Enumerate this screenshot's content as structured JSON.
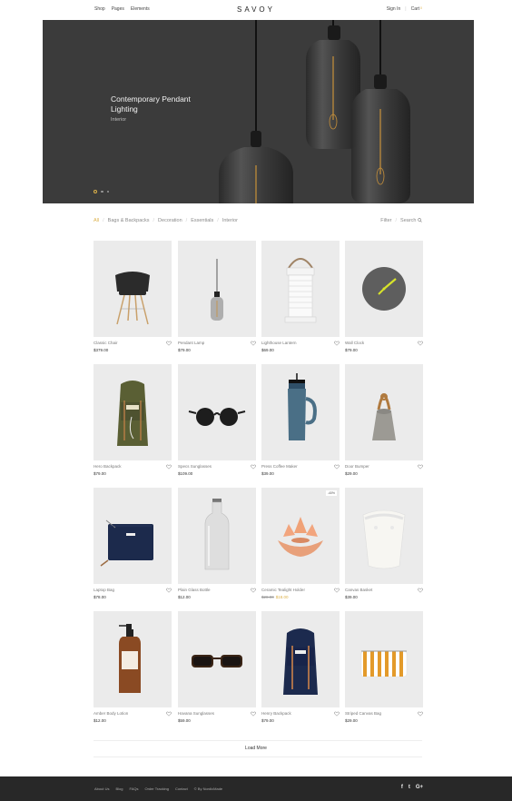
{
  "header": {
    "nav_left": [
      "Shop",
      "Pages",
      "Elements"
    ],
    "logo": "SAVOY",
    "sign_in": "Sign In",
    "cart": "Cart",
    "cart_count": "0"
  },
  "hero": {
    "title": "Contemporary Pendant Lighting",
    "subtitle": "Interior"
  },
  "filters": {
    "categories": [
      "All",
      "Bags & Backpacks",
      "Decoration",
      "Essentials",
      "Interior"
    ],
    "active": "All",
    "filter_label": "Filter",
    "search_label": "Search"
  },
  "products": [
    {
      "name": "Classic Chair",
      "price": "$379.00",
      "icon": "chair"
    },
    {
      "name": "Pendant Lamp",
      "price": "$79.00",
      "icon": "pendant-lamp"
    },
    {
      "name": "Lighthouse Lantern",
      "price": "$69.00",
      "icon": "lantern"
    },
    {
      "name": "Wall Clock",
      "price": "$79.00",
      "icon": "clock"
    },
    {
      "name": "Hero Backpack",
      "price": "$79.00",
      "icon": "backpack-olive"
    },
    {
      "name": "Specs Sunglasses",
      "price": "$109.00",
      "icon": "sunglasses-round"
    },
    {
      "name": "Press Coffee Maker",
      "price": "$39.00",
      "icon": "coffee-press"
    },
    {
      "name": "Door Bumper",
      "price": "$29.00",
      "icon": "door-bumper"
    },
    {
      "name": "Laptop Bag",
      "price": "$78.00",
      "icon": "laptop-bag"
    },
    {
      "name": "Plain Glass Bottle",
      "price": "$12.00",
      "icon": "glass-bottle"
    },
    {
      "name": "Ceramic Tealight Holder",
      "price_old": "$28.00",
      "price": "$18.00",
      "badge": "-40%",
      "icon": "tealight"
    },
    {
      "name": "Canvas Basket",
      "price": "$39.00",
      "icon": "canvas-basket"
    },
    {
      "name": "Amber Body Lotion",
      "price": "$12.00",
      "icon": "lotion-bottle"
    },
    {
      "name": "Havana Sunglasses",
      "price": "$59.00",
      "icon": "sunglasses-havana"
    },
    {
      "name": "Henry Backpack",
      "price": "$79.00",
      "icon": "backpack-navy"
    },
    {
      "name": "Striped Canvas Bag",
      "price": "$29.00",
      "icon": "striped-bag"
    }
  ],
  "load_more": "Load More",
  "footer": {
    "links": [
      "About Us",
      "Blog",
      "FAQs",
      "Order Tracking",
      "Contact",
      "© By NordicMade"
    ],
    "social": [
      "f",
      "t",
      "G+"
    ]
  },
  "colors": {
    "accent": "#dcb14a",
    "footer_bg": "#282828",
    "hero_bg": "#3b3b3b"
  }
}
